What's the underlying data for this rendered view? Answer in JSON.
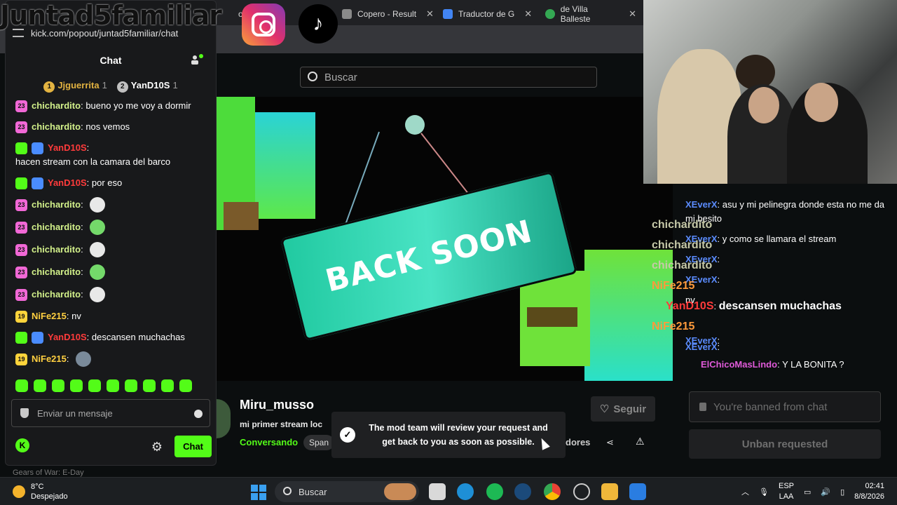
{
  "browser": {
    "tabs": [
      {
        "label": "kick.com/popout/juntad5familiar/chat",
        "color": "#53fc18"
      },
      {
        "label": "Copero - Result",
        "color": "#8a8a8a"
      },
      {
        "label": "Traductor de G",
        "color": "#4285f4"
      },
      {
        "label": "de Villa Balleste",
        "color": "#34a853"
      }
    ],
    "tab_fragment": "o S"
  },
  "overlay": {
    "logo_text": "Juntad5familiar"
  },
  "popout": {
    "url": "kick.com/popout/juntad5familiar/chat",
    "header": "Chat",
    "leaderboard": [
      {
        "rank": "1",
        "name": "Jjguerrita",
        "count": "1",
        "color": "#e3b341"
      },
      {
        "rank": "2",
        "name": "YanD10S",
        "count": "1",
        "color": "#c0c0c0"
      }
    ],
    "messages": [
      {
        "badge": "23",
        "user": "chichardito",
        "text": "bueno yo me voy a dormir",
        "style": "green"
      },
      {
        "badge": "23",
        "user": "chichardito",
        "text": "nos vemos",
        "style": "green"
      },
      {
        "badge": "",
        "user": "YanD10S",
        "text": "hacen stream con la camara del barco",
        "style": "red"
      },
      {
        "badge": "",
        "user": "YanD10S",
        "text": "por eso",
        "style": "red"
      },
      {
        "badge": "23",
        "user": "chichardito",
        "text": "",
        "style": "green",
        "emote": "#e8e8e8"
      },
      {
        "badge": "23",
        "user": "chichardito",
        "text": "",
        "style": "green",
        "emote": "#74d96a"
      },
      {
        "badge": "23",
        "user": "chichardito",
        "text": "",
        "style": "green",
        "emote": "#e8e8e8"
      },
      {
        "badge": "23",
        "user": "chichardito",
        "text": "",
        "style": "green",
        "emote": "#74d96a"
      },
      {
        "badge": "23",
        "user": "chichardito",
        "text": "",
        "style": "green",
        "emote": "#e8e8e8"
      },
      {
        "badge": "19",
        "user": "NiFe215",
        "text": "nv",
        "style": "yellow"
      },
      {
        "badge": "",
        "user": "YanD10S",
        "text": "descansen muchachas",
        "style": "red"
      },
      {
        "badge": "19",
        "user": "NiFe215",
        "text": "",
        "style": "yellow",
        "emote": "#7a8a9a"
      }
    ],
    "input_placeholder": "Enviar un mensaje",
    "chat_button": "Chat",
    "logo_letter": "K"
  },
  "page": {
    "search_placeholder": "Buscar",
    "player_sign": "BACK SOON",
    "streamer": "Miru_musso",
    "stream_title": "mi primer stream loc",
    "category": "Conversando",
    "language": "Span",
    "follow": "Seguir",
    "viewers_fragment": "dores",
    "toast": "The mod team will review your request and get back to you as soon as possible.",
    "next_row": "Gears of War: E-Day"
  },
  "right_chat": {
    "lines": [
      {
        "user": "XEverX",
        "text": "asu y mi pelinegra donde esta no me da mi besito"
      },
      {
        "ghost": "chichardito",
        "user": "XEverX",
        "text": "y como se llamara el stream"
      },
      {
        "ghost": "chichardito",
        "user": "XEverX",
        "text": ""
      },
      {
        "ghost": "chichardito",
        "user": "XEverX",
        "text": ""
      },
      {
        "ghost": "NiFe215",
        "user": "",
        "text": "nv"
      },
      {
        "ghost": "",
        "user": "YanD10S",
        "text": "descansen muchachas"
      },
      {
        "ghost": "NiFe215",
        "user": "XEverX",
        "text": ""
      },
      {
        "ghost": "",
        "user": "XEverX",
        "text": ""
      },
      {
        "ghost": "",
        "user": "ElChicoMasLindo",
        "text": "Y LA BONITA ?"
      }
    ],
    "banned": "You're banned from chat",
    "unban": "Unban requested"
  },
  "taskbar": {
    "temp": "8°C",
    "weather": "Despejado",
    "search": "Buscar",
    "lang": "ESP",
    "lang2": "LAA",
    "time": "02:41",
    "date": "8/8/2026"
  }
}
